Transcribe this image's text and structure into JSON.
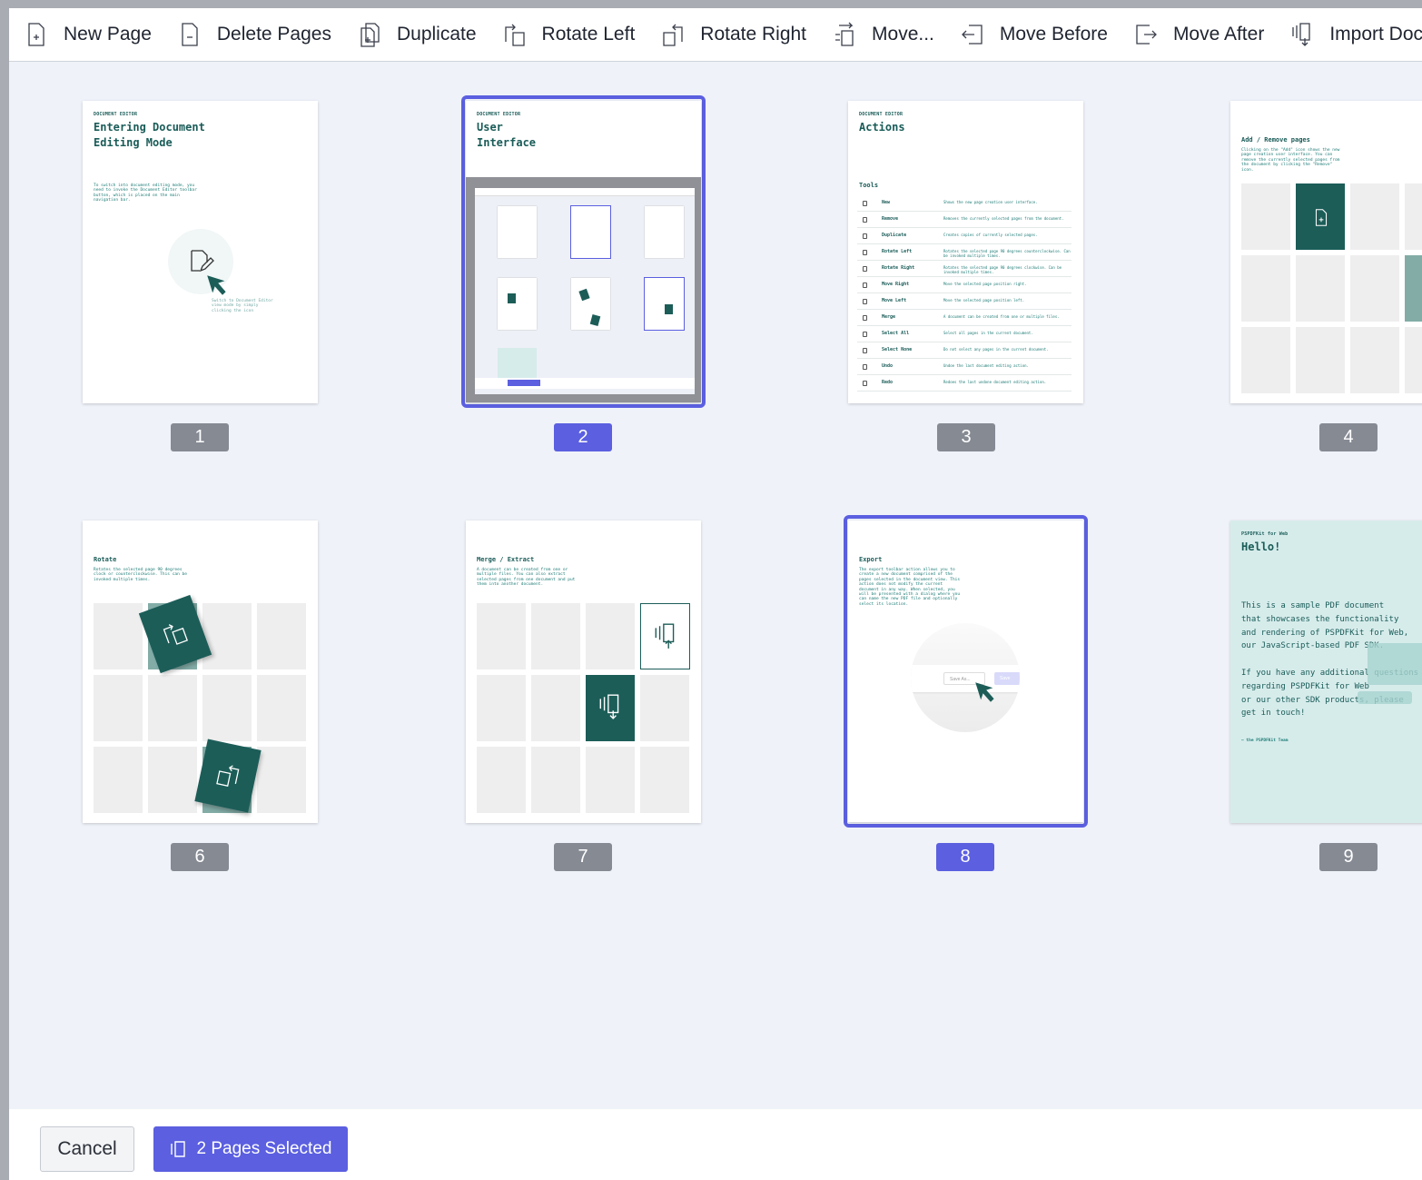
{
  "toolbar": {
    "new_page": "New Page",
    "delete_pages": "Delete Pages",
    "duplicate": "Duplicate",
    "rotate_left": "Rotate Left",
    "rotate_right": "Rotate Right",
    "move": "Move...",
    "move_before": "Move Before",
    "move_after": "Move After",
    "import": "Import Document"
  },
  "pages": [
    {
      "number": "1",
      "selected": false
    },
    {
      "number": "2",
      "selected": true
    },
    {
      "number": "3",
      "selected": false
    },
    {
      "number": "4",
      "selected": false
    },
    {
      "number": "6",
      "selected": false
    },
    {
      "number": "7",
      "selected": false
    },
    {
      "number": "8",
      "selected": true
    },
    {
      "number": "9",
      "selected": false
    }
  ],
  "page_content": {
    "p1": {
      "kicker": "DOCUMENT EDITOR",
      "title_line1": "Entering Document",
      "title_line2": "Editing Mode",
      "body": "To switch into document editing mode, you need to invoke the Document Editor toolbar button, which is placed on the main navigation bar.",
      "caption": "Switch to Document Editor view mode by simply clicking the icon"
    },
    "p2": {
      "kicker": "DOCUMENT EDITOR",
      "title_line1": "User",
      "title_line2": "Interface"
    },
    "p3": {
      "kicker": "DOCUMENT EDITOR",
      "title": "Actions",
      "tools_heading": "Tools",
      "actions": [
        {
          "name": "New",
          "desc": "Shows the new page creation user interface."
        },
        {
          "name": "Remove",
          "desc": "Removes the currently selected pages from the document."
        },
        {
          "name": "Duplicate",
          "desc": "Creates copies of currently selected pages."
        },
        {
          "name": "Rotate Left",
          "desc": "Rotates the selected page 90 degrees counterclockwise. Can be invoked multiple times."
        },
        {
          "name": "Rotate Right",
          "desc": "Rotates the selected page 90 degrees clockwise. Can be invoked multiple times."
        },
        {
          "name": "Move Right",
          "desc": "Move the selected page position right."
        },
        {
          "name": "Move Left",
          "desc": "Move the selected page position left."
        },
        {
          "name": "Merge",
          "desc": "A document can be created from one or multiple files."
        },
        {
          "name": "Select All",
          "desc": "Select all pages in the current document."
        },
        {
          "name": "Select None",
          "desc": "Do not select any pages in the current document."
        },
        {
          "name": "Undo",
          "desc": "Undoe the last document editing action."
        },
        {
          "name": "Redo",
          "desc": "Redoes the last undone document editing action."
        }
      ]
    },
    "p4": {
      "title": "Add / Remove pages",
      "body": "Clicking on the \"Add\" icon shows the new page creation user interface. You can remove the currently selected pages from the document by clicking the \"Remove\" icon."
    },
    "p6": {
      "title": "Rotate",
      "body": "Rotates the selected page 90 degrees clock or counterclockwise. This can be invoked multiple times."
    },
    "p7": {
      "title": "Merge / Extract",
      "body": "A document can be created from one or multiple files. You can also extract selected pages from one document and put them into another document."
    },
    "p8": {
      "title": "Export",
      "body": "The export toolbar action allows you to create a new document comprised of the pages selected in the document view. This action does not modify the current document in any way. When selected, you will be presented with a dialog where you can name the new PDF file and optionally select its location.",
      "save_as": "Save As...",
      "save": "Save"
    },
    "p9": {
      "kicker": "PSPDFKit for Web",
      "title": "Hello!",
      "body": "This is a sample PDF document\nthat showcases the functionality\nand rendering of PSPDFKit for Web,\nour JavaScript-based PDF SDK.\n\nIf you have any additional questions\nregarding PSPDFKit for Web\nor our other SDK products, please\nget in touch!",
      "signature": "– the PSPDFKit Team"
    }
  },
  "footer": {
    "cancel_label": "Cancel",
    "selected_label": "2 Pages Selected"
  },
  "colors": {
    "accent": "#5b5fe0",
    "teal_dark": "#1c5d58",
    "badge_gray": "#858a93",
    "canvas": "#eff2f9"
  }
}
